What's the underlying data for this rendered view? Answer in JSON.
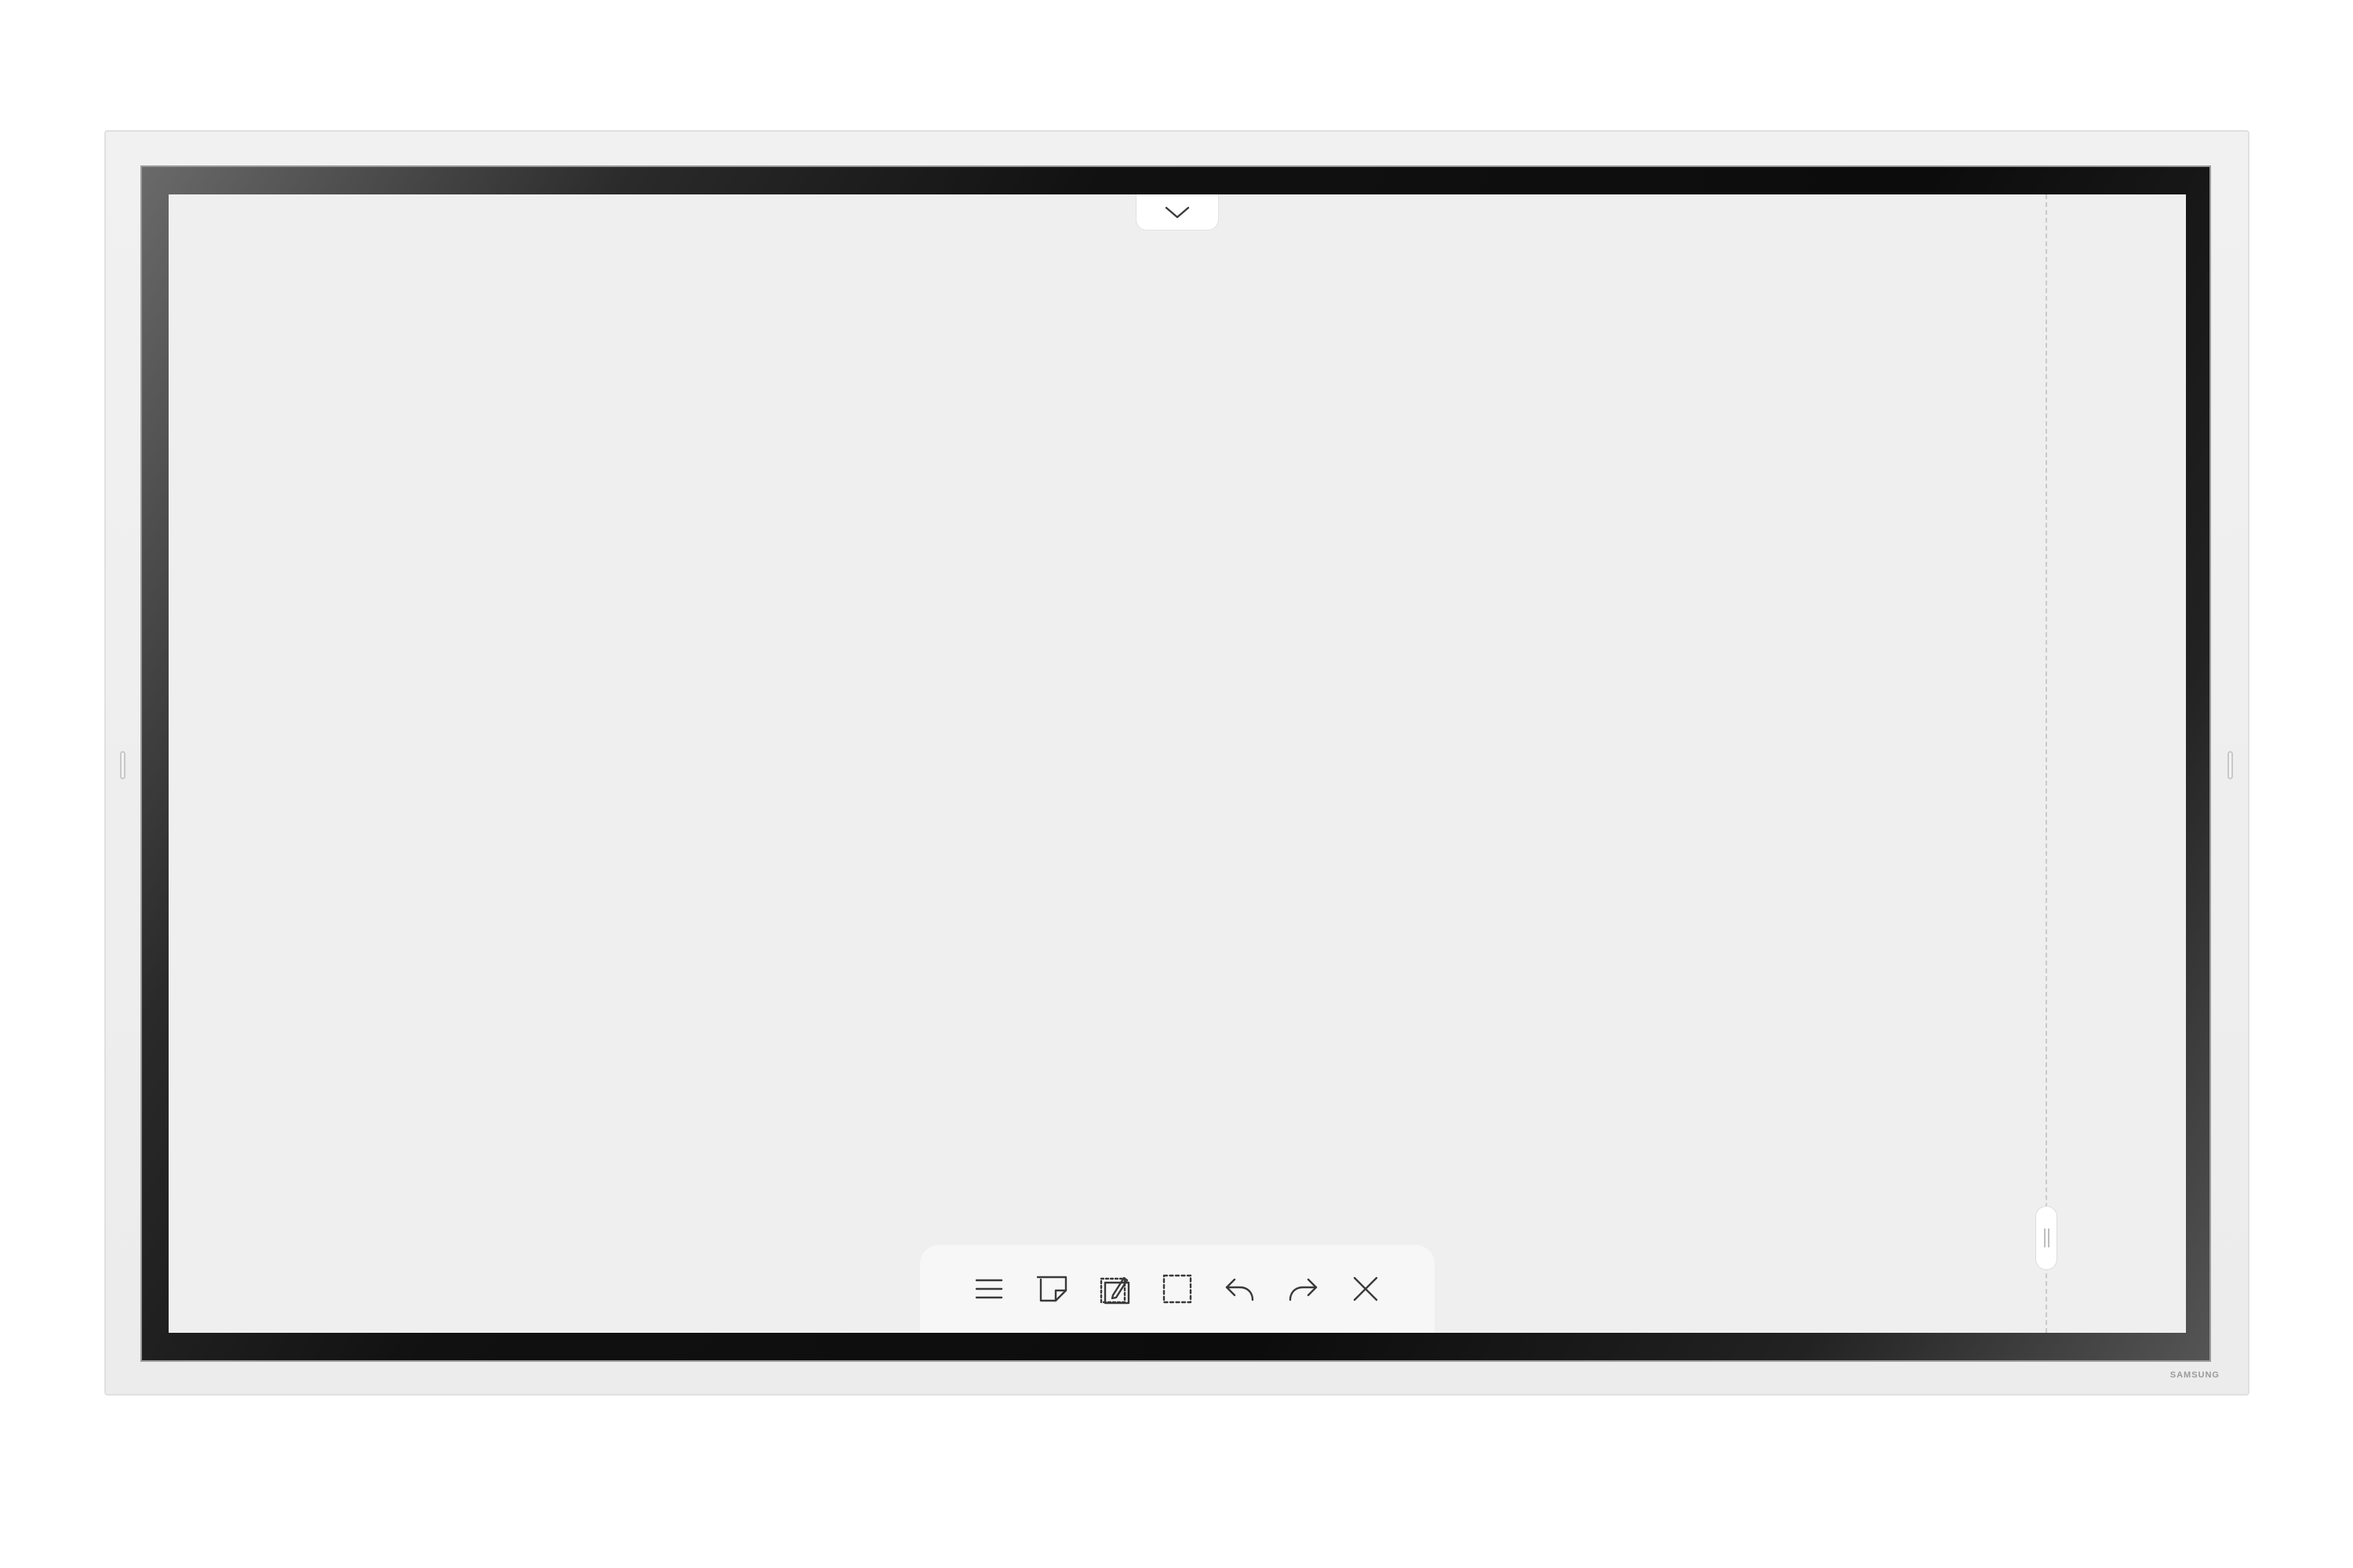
{
  "device": {
    "brand": "SAMSUNG"
  },
  "screen": {
    "background": "#efefef",
    "top_tab_icon": "chevron-down-icon",
    "drag_handle_icon": "grip-icon"
  },
  "toolbar": {
    "items": [
      {
        "name": "menu",
        "icon": "menu-icon"
      },
      {
        "name": "sticky-note",
        "icon": "sticky-note-icon"
      },
      {
        "name": "capture",
        "icon": "capture-edit-icon"
      },
      {
        "name": "select",
        "icon": "selection-icon"
      },
      {
        "name": "undo",
        "icon": "undo-icon"
      },
      {
        "name": "redo",
        "icon": "redo-icon"
      },
      {
        "name": "close",
        "icon": "close-icon"
      }
    ]
  }
}
